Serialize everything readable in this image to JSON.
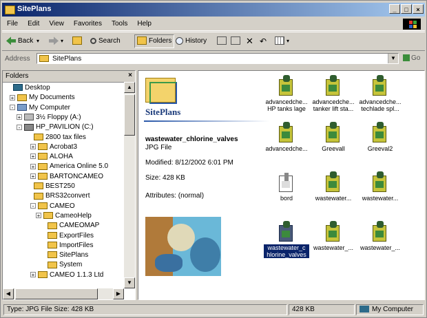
{
  "window": {
    "title": "SitePlans",
    "btn_min": "_",
    "btn_max": "□",
    "btn_close": "×"
  },
  "menu": [
    "File",
    "Edit",
    "View",
    "Favorites",
    "Tools",
    "Help"
  ],
  "toolbar": {
    "back": "Back",
    "search": "Search",
    "folders": "Folders",
    "history": "History"
  },
  "address": {
    "label": "Address",
    "value": "SitePlans",
    "go": "Go"
  },
  "folder_pane": {
    "title": "Folders",
    "items": [
      {
        "label": "Desktop",
        "expander": "",
        "icon": "dk"
      },
      {
        "label": "My Documents",
        "expander": "+",
        "icon": ""
      },
      {
        "label": "My Computer",
        "expander": "-",
        "icon": "pc"
      },
      {
        "label": "3½ Floppy (A:)",
        "expander": "+",
        "icon": "fl"
      },
      {
        "label": "HP_PAVILION (C:)",
        "expander": "-",
        "icon": "dr"
      },
      {
        "label": "2800 tax files",
        "expander": "",
        "icon": ""
      },
      {
        "label": "Acrobat3",
        "expander": "+",
        "icon": ""
      },
      {
        "label": "ALOHA",
        "expander": "+",
        "icon": ""
      },
      {
        "label": "America Online 5.0",
        "expander": "+",
        "icon": ""
      },
      {
        "label": "BARTONCAMEO",
        "expander": "+",
        "icon": ""
      },
      {
        "label": "BEST250",
        "expander": "",
        "icon": ""
      },
      {
        "label": "BRS32convert",
        "expander": "",
        "icon": ""
      },
      {
        "label": "CAMEO",
        "expander": "-",
        "icon": ""
      },
      {
        "label": "CameoHelp",
        "expander": "+",
        "icon": ""
      },
      {
        "label": "CAMEOMAP",
        "expander": "",
        "icon": ""
      },
      {
        "label": "ExportFiles",
        "expander": "",
        "icon": ""
      },
      {
        "label": "ImportFiles",
        "expander": "",
        "icon": ""
      },
      {
        "label": "SitePlans",
        "expander": "",
        "icon": ""
      },
      {
        "label": "System",
        "expander": "",
        "icon": ""
      },
      {
        "label": "CAMEO 1.1.3 Ltd",
        "expander": "+",
        "icon": ""
      }
    ]
  },
  "details": {
    "folder_title": "SitePlans",
    "selected_name": "wastewater_chlorine_valves",
    "selected_type": "JPG File",
    "modified": "Modified: 8/12/2002 6:01 PM",
    "size": "Size: 428 KB",
    "attributes": "Attributes: (normal)"
  },
  "files": [
    {
      "label": "advancedche... HP tanks lage",
      "kind": "img"
    },
    {
      "label": "advancedche... tanker lift sta...",
      "kind": "img"
    },
    {
      "label": "advancedche... techlade spl...",
      "kind": "img"
    },
    {
      "label": "advancedche...",
      "kind": "img"
    },
    {
      "label": "Greevall",
      "kind": "img"
    },
    {
      "label": "Greeval2",
      "kind": "img"
    },
    {
      "label": "bord",
      "kind": "doc"
    },
    {
      "label": "wastewater...",
      "kind": "img"
    },
    {
      "label": "wastewater...",
      "kind": "img"
    },
    {
      "label": "wastewater_c hlorine_valves",
      "kind": "dark",
      "selected": true
    },
    {
      "label": "wastewater_...",
      "kind": "img"
    },
    {
      "label": "wastewater_...",
      "kind": "img"
    }
  ],
  "statusbar": {
    "info": "Type: JPG File Size: 428 KB",
    "size": "428 KB",
    "zone": "My Computer"
  }
}
